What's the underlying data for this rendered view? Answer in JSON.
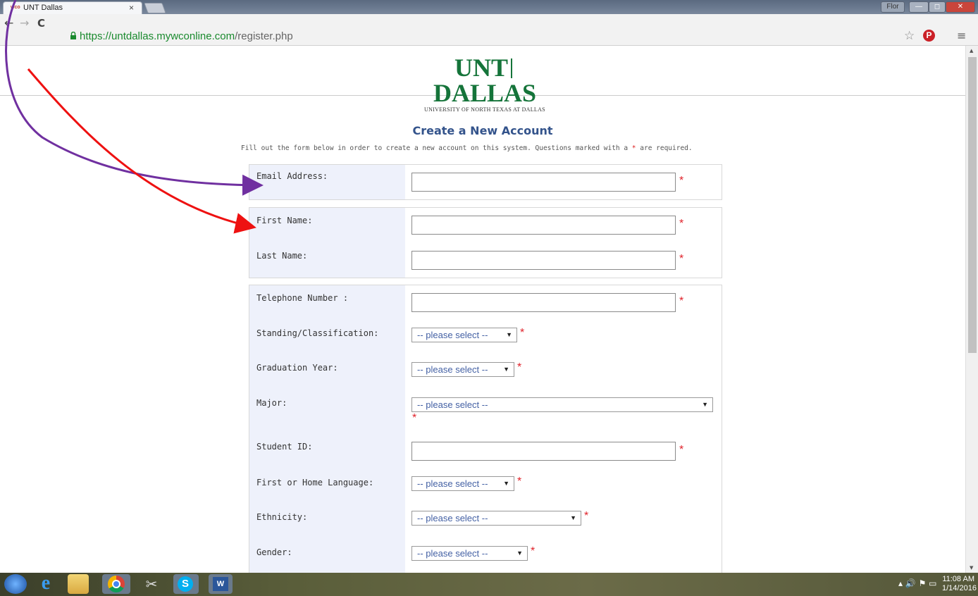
{
  "browser": {
    "tab_favicon": "wco",
    "tab_title": "UNT Dallas",
    "tab_close": "×",
    "user_button": "Flor",
    "url_host": "https://untdallas.mywconline.com",
    "url_path": "/register.php",
    "menu_icon": "≡"
  },
  "logo": {
    "main_left": "UNT",
    "main_right": "DALLAS",
    "sub": "UNIVERSITY OF NORTH TEXAS AT DALLAS"
  },
  "form": {
    "title": "Create a New Account",
    "intro_before": "Fill out the form below in order to create a new account on this system. Questions marked with a ",
    "intro_star": "*",
    "intro_after": " are required.",
    "required_mark": "*",
    "fields": {
      "email": "Email Address:",
      "first_name": "First Name:",
      "last_name": "Last Name:",
      "telephone": "Telephone Number :",
      "standing": "Standing/Classification:",
      "grad_year": "Graduation Year:",
      "major": "Major:",
      "student_id": "Student ID:",
      "language": "First or Home Language:",
      "ethnicity": "Ethnicity:",
      "gender": "Gender:"
    },
    "select_placeholder": "-- please select --"
  },
  "taskbar": {
    "time": "11:08 AM",
    "date": "1/14/2016"
  },
  "colors": {
    "arrow_purple": "#7030a0",
    "arrow_red": "#ee1111",
    "required": "#e0232b",
    "title_blue": "#33538b",
    "logo_green": "#15743a"
  }
}
